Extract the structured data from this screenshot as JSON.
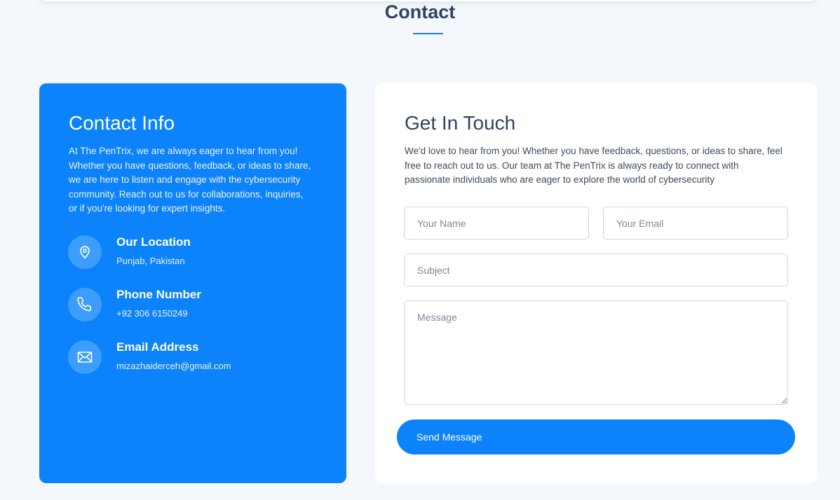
{
  "section": {
    "title": "Contact"
  },
  "contact_info": {
    "title": "Contact Info",
    "intro": "At The PenTrix, we are always eager to hear from you! Whether you have questions, feedback, or ideas to share, we are here to listen and engage with the cybersecurity community. Reach out to us for collaborations, inquiries, or if you're looking for expert insights.",
    "items": [
      {
        "icon": "location-pin-icon",
        "title": "Our Location",
        "value": "Punjab, Pakistan"
      },
      {
        "icon": "phone-icon",
        "title": "Phone Number",
        "value": "+92 306 6150249"
      },
      {
        "icon": "envelope-icon",
        "title": "Email Address",
        "value": "mizazhaiderceh@gmail.com"
      }
    ]
  },
  "form": {
    "title": "Get In Touch",
    "intro": "We'd love to hear from you! Whether you have feedback, questions, or ideas to share, feel free to reach out to us. Our team at The PenTrix is always ready to connect with passionate individuals who are eager to explore the world of cybersecurity",
    "name_placeholder": "Your Name",
    "email_placeholder": "Your Email",
    "subject_placeholder": "Subject",
    "message_placeholder": "Message",
    "submit_label": "Send Message"
  },
  "colors": {
    "accent": "#0d83fb",
    "background": "#f4f8fd",
    "heading": "#2f4461"
  }
}
